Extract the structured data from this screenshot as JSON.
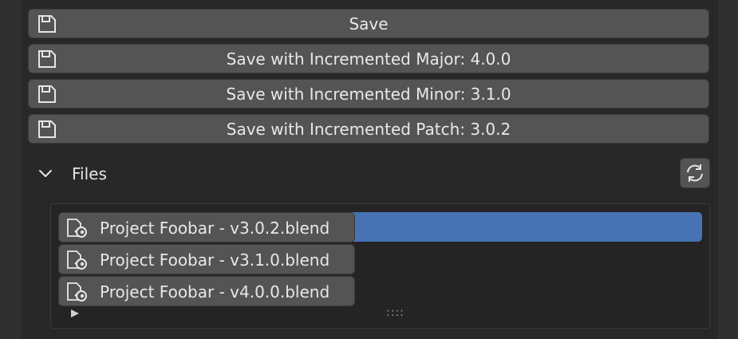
{
  "save_buttons": [
    {
      "label": "Save",
      "icon": "save-icon"
    },
    {
      "label": "Save with Incremented Major: 4.0.0",
      "icon": "save-icon"
    },
    {
      "label": "Save with Incremented Minor: 3.1.0",
      "icon": "save-icon"
    },
    {
      "label": "Save with Incremented Patch: 3.0.2",
      "icon": "save-icon"
    }
  ],
  "files": {
    "title": "Files",
    "expanded": true,
    "refresh_icon": "refresh-icon",
    "selected_index": 0,
    "items": [
      {
        "label": "Project Foobar - v3.0.2.blend",
        "icon": "blend-file-icon"
      },
      {
        "label": "Project Foobar - v3.1.0.blend",
        "icon": "blend-file-icon"
      },
      {
        "label": "Project Foobar - v4.0.0.blend",
        "icon": "blend-file-icon"
      }
    ],
    "resize_grip": "::::"
  },
  "colors": {
    "selection": "#4772b3",
    "button": "#545454",
    "panel": "#282828"
  }
}
